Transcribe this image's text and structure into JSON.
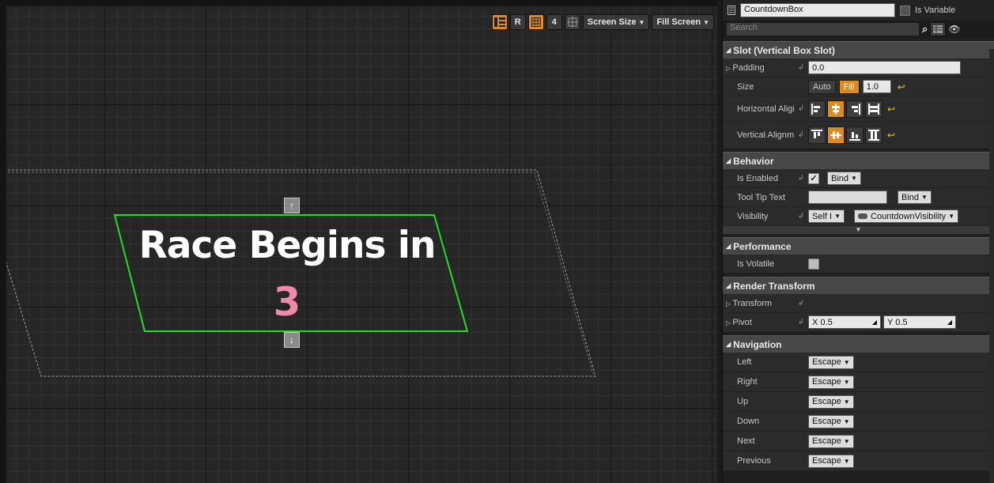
{
  "viewport_toolbar": {
    "r_label": "R",
    "snap_value": "4",
    "screen_size_label": "Screen Size",
    "fill_screen_label": "Fill Screen"
  },
  "canvas": {
    "headline": "Race Begins in",
    "countdown_number": "3",
    "countdown_color": "#f08aaa",
    "selection_color": "#22dd22"
  },
  "details": {
    "widget_name": "CountdownBox",
    "is_variable_label": "Is Variable",
    "search_placeholder": "Search",
    "slot": {
      "title": "Slot (Vertical Box Slot)",
      "padding_label": "Padding",
      "padding_value": "0.0",
      "size_label": "Size",
      "size_auto": "Auto",
      "size_fill": "Fill",
      "size_value": "1.0",
      "halign_label": "Horizontal Aligi",
      "valign_label": "Vertical Alignm"
    },
    "behavior": {
      "title": "Behavior",
      "is_enabled_label": "Is Enabled",
      "bind_label": "Bind",
      "tooltip_label": "Tool Tip Text",
      "visibility_label": "Visibility",
      "visibility_value": "Self I",
      "visibility_binding": "CountdownVisibility"
    },
    "performance": {
      "title": "Performance",
      "is_volatile_label": "Is Volatile"
    },
    "render_transform": {
      "title": "Render Transform",
      "transform_label": "Transform",
      "pivot_label": "Pivot",
      "pivot_x": "X  0.5",
      "pivot_y": "Y  0.5"
    },
    "navigation": {
      "title": "Navigation",
      "rows": [
        {
          "label": "Left",
          "value": "Escape"
        },
        {
          "label": "Right",
          "value": "Escape"
        },
        {
          "label": "Up",
          "value": "Escape"
        },
        {
          "label": "Down",
          "value": "Escape"
        },
        {
          "label": "Next",
          "value": "Escape"
        },
        {
          "label": "Previous",
          "value": "Escape"
        }
      ]
    }
  },
  "colors": {
    "accent": "#e08a1e",
    "reset_arrow": "#e6c02c"
  }
}
